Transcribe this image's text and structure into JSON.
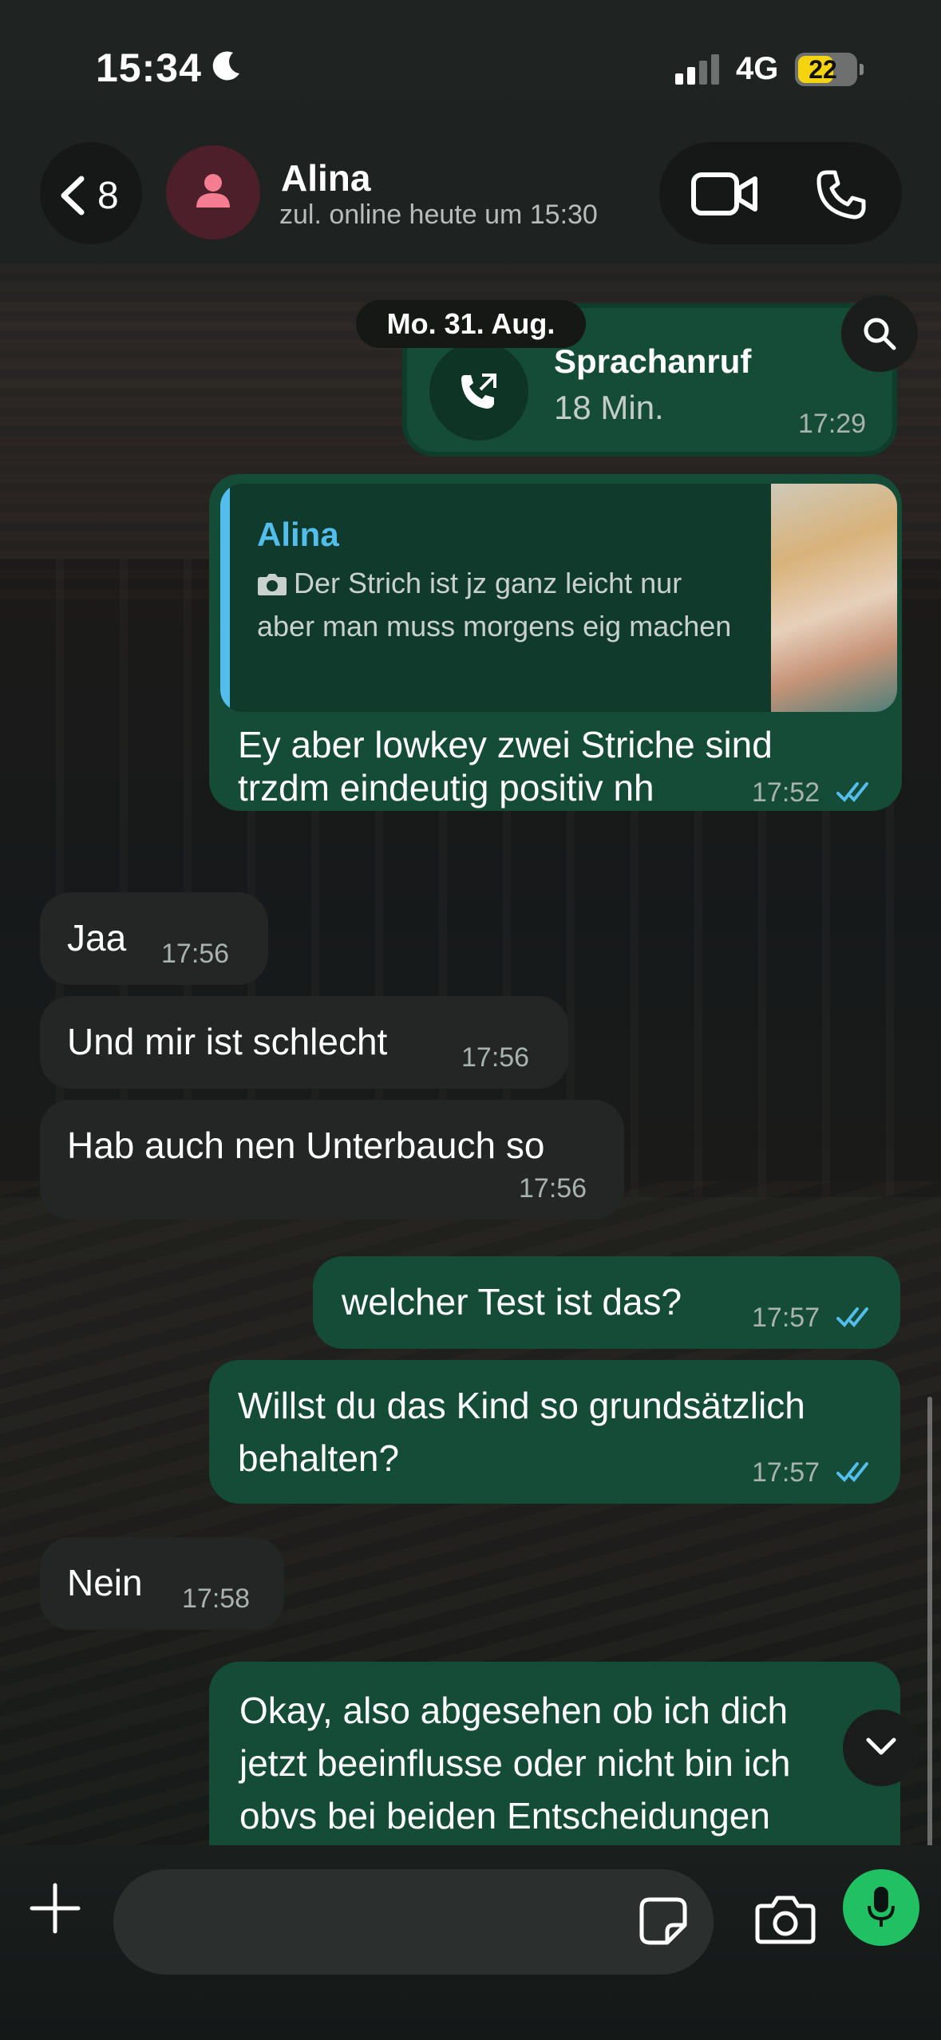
{
  "status_bar": {
    "time": "15:34",
    "network": "4G",
    "battery": "22"
  },
  "header": {
    "back_count": "8",
    "contact_name": "Alina",
    "contact_status": "zul. online heute um 15:30"
  },
  "chat": {
    "date_label": "Mo. 31. Aug.",
    "call": {
      "title": "Sprachanruf",
      "duration": "18 Min.",
      "time": "17:29"
    },
    "reply_message": {
      "quote_name": "Alina",
      "quote_text": "Der Strich ist jz ganz leicht nur aber man muss morgens eig machen",
      "line1": "Ey aber lowkey zwei Striche sind",
      "line2": "trzdm eindeutig positiv nh",
      "time": "17:52"
    },
    "messages": [
      {
        "direction": "in",
        "text": "Jaa",
        "time": "17:56"
      },
      {
        "direction": "in",
        "text": "Und mir ist schlecht",
        "time": "17:56"
      },
      {
        "direction": "in",
        "text": "Hab auch nen Unterbauch so",
        "time": "17:56"
      },
      {
        "direction": "out",
        "text": "welcher Test ist das?",
        "time": "17:57"
      },
      {
        "direction": "out",
        "line1": "Willst du das Kind so grundsätzlich",
        "line2": "behalten?",
        "time": "17:57"
      },
      {
        "direction": "in",
        "text": "Nein",
        "time": "17:58"
      },
      {
        "direction": "out",
        "line1": "Okay, also abgesehen ob ich dich",
        "line2": "jetzt beeinflusse oder nicht bin ich",
        "line3": "obvs bei beiden Entscheidungen"
      }
    ]
  },
  "composer": {
    "placeholder": ""
  },
  "colors": {
    "outgoing": "#144c38",
    "incoming": "#232624",
    "accent": "#21c063",
    "read_ticks": "#53bdeb"
  },
  "icons": [
    "moon-icon",
    "signal-icon",
    "back-chevron-icon",
    "person-icon",
    "video-call-icon",
    "phone-icon",
    "search-icon",
    "outgoing-call-icon",
    "camera-icon",
    "read-ticks-icon",
    "chevron-down-icon",
    "plus-icon",
    "sticker-icon",
    "microphone-icon"
  ]
}
